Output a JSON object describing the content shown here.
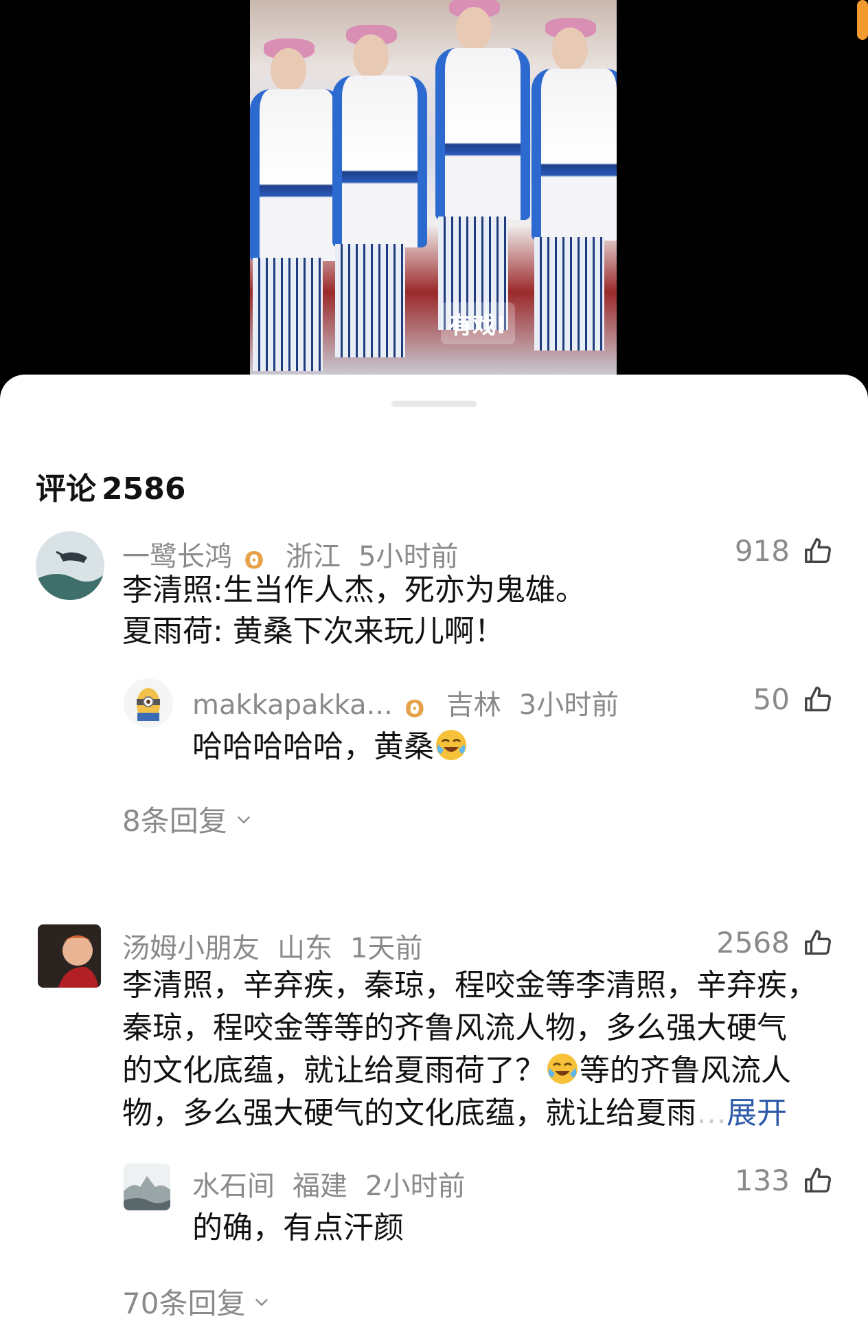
{
  "comments_header": {
    "label": "评论",
    "count": "2586"
  },
  "comments": [
    {
      "user": "一鹭长鸿",
      "location": "浙江",
      "time": "5小时前",
      "likes": "918",
      "text_line1": "李清照:生当作人杰，死亦为鬼雄。",
      "text_line2": "夏雨荷: 黄桑下次来玩儿啊！",
      "reply": {
        "user": "makkapakka...",
        "location": "吉林",
        "time": "3小时前",
        "likes": "50",
        "text": "哈哈哈哈哈，黄桑"
      },
      "replies_count_label": "8条回复"
    },
    {
      "user": "汤姆小朋友",
      "location": "山东",
      "time": "1天前",
      "likes": "2568",
      "text_line1": "李清照，辛弃疾，秦琼，程咬金等李清照，辛弃疾，",
      "text_line2": "秦琼，程咬金等等的齐鲁风流人物，多么强大硬气",
      "text_line3": "的文化底蕴，就让给夏雨荷了？",
      "text_line3b": "等的齐鲁风流人",
      "text_line4": "物，多么强大硬气的文化底蕴，就让给夏雨",
      "expand_label": "展开",
      "reply": {
        "user": "水石间",
        "location": "福建",
        "time": "2小时前",
        "likes": "133",
        "text": "的确，有点汗颜"
      },
      "replies_count_label": "70条回复"
    }
  ],
  "video": {
    "watermark": "有戏!"
  },
  "colors": {
    "accent_link": "#2c5aa8",
    "meta_gray": "#8a8a8a",
    "badge": "#e5a24a"
  }
}
